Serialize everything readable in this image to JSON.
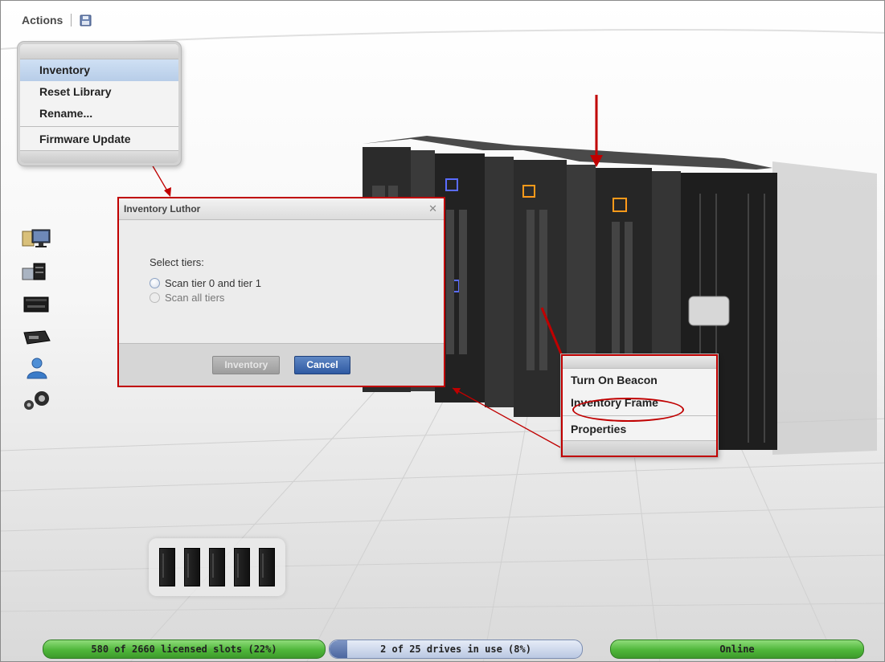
{
  "toolbar": {
    "actions_label": "Actions",
    "save_icon": "save-icon"
  },
  "actions_menu": {
    "items": [
      "Inventory",
      "Reset Library",
      "Rename...",
      "Firmware Update"
    ]
  },
  "dialog": {
    "title": "Inventory Luthor",
    "close_glyph": "✕",
    "prompt": "Select tiers:",
    "options": [
      "Scan tier 0 and tier 1",
      "Scan all tiers"
    ],
    "buttons": {
      "inventory": "Inventory",
      "cancel": "Cancel"
    }
  },
  "frame_menu": {
    "items": [
      "Turn On Beacon",
      "Inventory Frame",
      "Properties"
    ]
  },
  "side_icons": [
    "monitor-icon",
    "drives-icon",
    "drive-icon",
    "cartridge-icon",
    "user-icon",
    "gears-icon"
  ],
  "statusbar": {
    "slots": "580 of 2660 licensed slots (22%)",
    "drives": "2 of 25 drives in use (8%)",
    "state": "Online"
  },
  "colors": {
    "annotation": "#c00000",
    "status_green": "#4fb63a",
    "primary_button": "#2f5aa3"
  }
}
